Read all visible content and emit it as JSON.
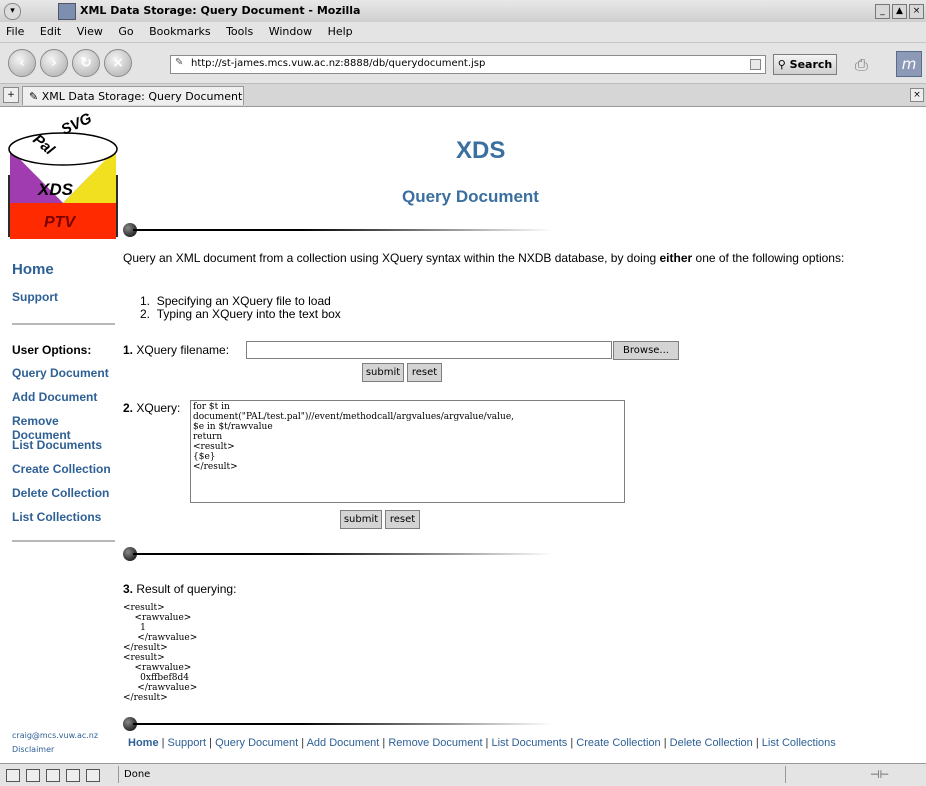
{
  "window": {
    "title": "XML Data Storage: Query Document - Mozilla",
    "menu_icon": "window-menu-icon",
    "controls": [
      "_",
      "▲",
      "×"
    ]
  },
  "menubar": {
    "items": [
      "File",
      "Edit",
      "View",
      "Go",
      "Bookmarks",
      "Tools",
      "Window",
      "Help"
    ]
  },
  "toolbar": {
    "back": "back-icon",
    "forward": "forward-icon",
    "reload": "reload-icon",
    "stop": "stop-icon",
    "url": "http://st-james.mcs.vuw.ac.nz:8888/db/querydocument.jsp",
    "search_label": "Search",
    "throbber": "m"
  },
  "tabs": [
    {
      "label": "XML Data Storage: Query Document"
    }
  ],
  "logo": {
    "top_left": "Pal",
    "top_right": "SVG",
    "middle": "XDS",
    "bottom": "PTV"
  },
  "sidebar": {
    "home": "Home",
    "support": "Support",
    "user_options_label": "User Options:",
    "items": [
      "Query Document",
      "Add Document",
      "Remove Document",
      "List Documents",
      "Create Collection",
      "Delete Collection",
      "List Collections"
    ],
    "email": "craig@mcs.vuw.ac.nz",
    "disclaimer": "Disclaimer"
  },
  "main": {
    "title": "XDS",
    "subtitle": "Query Document",
    "intro_pre": "Query an XML document from a collection using XQuery syntax within the NXDB database, by doing ",
    "intro_bold": "either",
    "intro_post": " one of the following options:",
    "options": [
      "Specifying an XQuery file to load",
      "Typing an XQuery into the text box"
    ],
    "q1_num": "1.",
    "q1_label": " XQuery filename:",
    "browse": "Browse...",
    "submit": "submit",
    "reset": "reset",
    "q2_num": "2.",
    "q2_label": " XQuery:",
    "xquery": "for $t in\ndocument(\"PAL/test.pal\")//event/methodcall/argvalues/argvalue/value,\n$e in $t/rawvalue\nreturn\n<result>\n{$e}\n</result>",
    "q3_num": "3.",
    "q3_label": " Result of querying:",
    "result": "<result>\n    <rawvalue>\n      1\n     </rawvalue>\n</result>\n<result>\n    <rawvalue>\n      0xffbef8d4\n     </rawvalue>\n</result>"
  },
  "footer": {
    "links": [
      "Home",
      "Support",
      "Query Document",
      "Add Document",
      "Remove Document",
      "List Documents",
      "Create Collection",
      "Delete Collection",
      "List Collections"
    ]
  },
  "status": {
    "text": "Done"
  }
}
